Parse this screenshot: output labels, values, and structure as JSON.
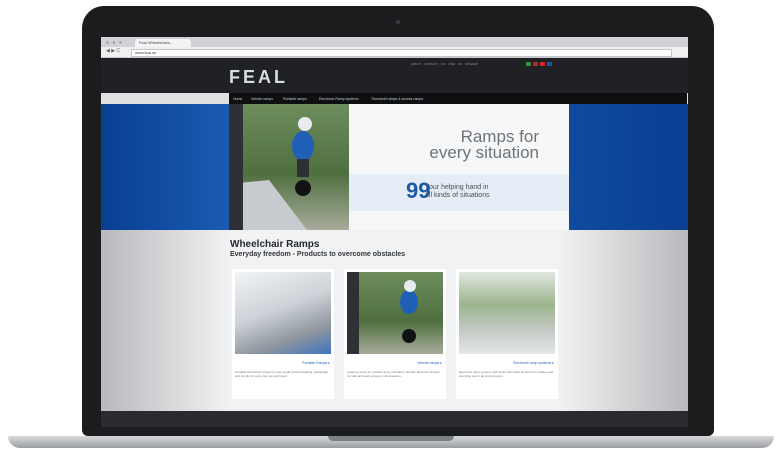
{
  "browser": {
    "window_dots": "● ● ●",
    "tab_title": "Feal Wheelchairs...",
    "nav_buttons": "◀ ▶ C",
    "url": "www.feal.se"
  },
  "header": {
    "logo": "FEAL",
    "top_links": "ABOUT  CONTACT US  FIND US  SITEMAP"
  },
  "nav": {
    "items": [
      "Home",
      "Vehicle ramps",
      "Portable ramps",
      "Electronic Ramp systems",
      "Threshold ramps & access ramps"
    ]
  },
  "hero": {
    "title_line1": "Ramps for",
    "title_line2": "every situation",
    "quote_mark": "99",
    "quote_line1": "Your helping hand in",
    "quote_line2": "all kinds of situations"
  },
  "content": {
    "heading": "Wheelchair Ramps",
    "subheading": "Everyday freedom - Products to overcome obstacles"
  },
  "cards": [
    {
      "link": "Portable Ramps ▸",
      "text": "Portable wheelchair ramps for easy loading and unloading, lightweight and sturdy for every day use and travel."
    },
    {
      "link": "Vehicle ramps ▸",
      "text": "Loading ramps for vehicles and motorbikes, durable aluminum design for safe and easy access in all situations."
    },
    {
      "link": "Electronic ramp systems ▸",
      "text": "Electronic ramp systems with smart automatic function for vehicles and everyday use in all environments."
    }
  ],
  "colors": {
    "accent": "#1a5aa8",
    "header_bg": "#202124",
    "hero_blue": "#1f66bd"
  }
}
